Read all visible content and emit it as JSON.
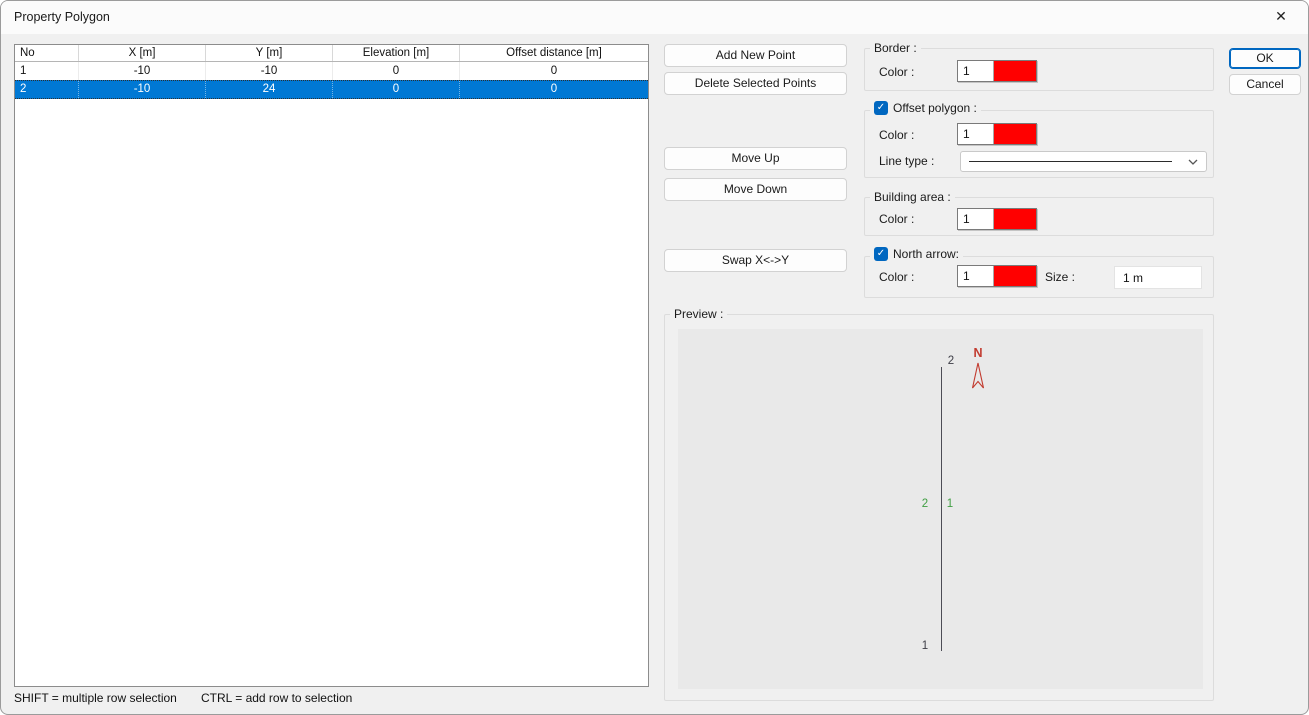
{
  "window": {
    "title": "Property Polygon",
    "close_glyph": "✕"
  },
  "icons": {
    "check": "✓",
    "chevron_down": "chevron-down",
    "close": "✕"
  },
  "colors": {
    "swatch_red": "#ff0000",
    "selection_blue": "#0078d4",
    "accent_blue": "#0067c0",
    "segment_green": "#3f9e42",
    "north_red": "#c23b2f"
  },
  "table": {
    "columns": [
      "No",
      "X [m]",
      "Y [m]",
      "Elevation [m]",
      "Offset distance [m]"
    ],
    "rows": [
      {
        "no": "1",
        "x": "-10",
        "y": "-10",
        "elevation": "0",
        "offset": "0",
        "selected": false
      },
      {
        "no": "2",
        "x": "-10",
        "y": "24",
        "elevation": "0",
        "offset": "0",
        "selected": true
      }
    ]
  },
  "actions": {
    "add": "Add New Point",
    "delete": "Delete Selected Points",
    "move_up": "Move Up",
    "move_down": "Move Down",
    "swap": "Swap X<->Y"
  },
  "groups": {
    "border": {
      "title": "Border :",
      "color_label": "Color :",
      "color_value": "1"
    },
    "offset_polygon": {
      "title": "Offset polygon :",
      "checked": true,
      "color_label": "Color :",
      "color_value": "1",
      "line_type_label": "Line type :"
    },
    "building_area": {
      "title": "Building area :",
      "color_label": "Color :",
      "color_value": "1"
    },
    "north_arrow": {
      "title": "North arrow:",
      "checked": true,
      "color_label": "Color :",
      "color_value": "1",
      "size_label": "Size :",
      "size_value": "1 m"
    }
  },
  "preview": {
    "title": "Preview :",
    "north_label": "N",
    "point_label_top": "2",
    "point_label_bottom": "1",
    "segment_label_left": "2",
    "segment_label_right": "1"
  },
  "dialog_buttons": {
    "ok": "OK",
    "cancel": "Cancel"
  },
  "status_bar": {
    "shift_hint": "SHIFT = multiple row selection",
    "ctrl_hint": "CTRL = add row to selection"
  }
}
